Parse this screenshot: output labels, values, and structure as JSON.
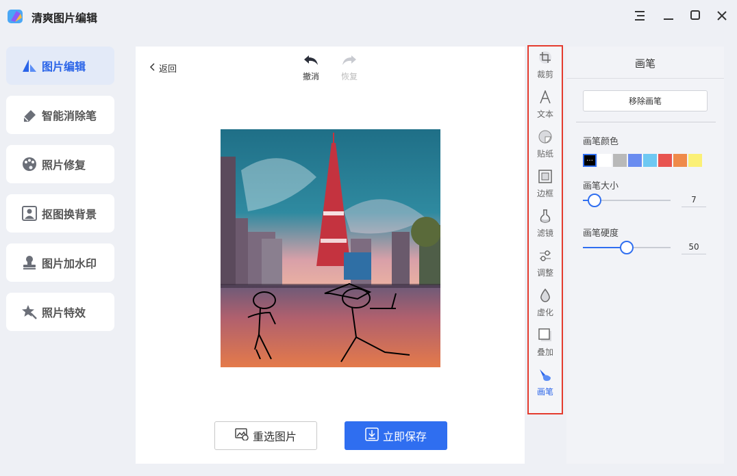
{
  "app": {
    "title": "清爽图片编辑"
  },
  "colors": {
    "accent": "#2f6ef0",
    "highlight_border": "#e43a2d"
  },
  "nav": {
    "items": [
      {
        "label": "图片编辑",
        "icon": "image-edit-icon",
        "active": true
      },
      {
        "label": "智能消除笔",
        "icon": "eraser-icon",
        "active": false
      },
      {
        "label": "照片修复",
        "icon": "palette-icon",
        "active": false
      },
      {
        "label": "抠图换背景",
        "icon": "portrait-cutout-icon",
        "active": false
      },
      {
        "label": "图片加水印",
        "icon": "stamp-icon",
        "active": false
      },
      {
        "label": "照片特效",
        "icon": "magic-wand-icon",
        "active": false
      }
    ]
  },
  "editor": {
    "back_label": "返回",
    "undo_label": "撤消",
    "redo_label": "恢复",
    "reselect_label": "重选图片",
    "save_label": "立即保存"
  },
  "tools": [
    {
      "label": "裁剪",
      "icon": "crop-icon",
      "active": false
    },
    {
      "label": "文本",
      "icon": "text-icon",
      "active": false
    },
    {
      "label": "贴纸",
      "icon": "sticker-icon",
      "active": false
    },
    {
      "label": "边框",
      "icon": "border-frame-icon",
      "active": false
    },
    {
      "label": "滤镜",
      "icon": "filter-flask-icon",
      "active": false
    },
    {
      "label": "调整",
      "icon": "adjust-sliders-icon",
      "active": false
    },
    {
      "label": "虚化",
      "icon": "blur-drop-icon",
      "active": false
    },
    {
      "label": "叠加",
      "icon": "overlay-icon",
      "active": false
    },
    {
      "label": "画笔",
      "icon": "brush-icon",
      "active": true
    }
  ],
  "brush_panel": {
    "title": "画笔",
    "remove_label": "移除画笔",
    "color_label": "画笔颜色",
    "colors": [
      "#000000",
      "#ffffff",
      "#b9b9b9",
      "#6a8cf0",
      "#6ec8f2",
      "#e85450",
      "#ef8a4a",
      "#fbf076"
    ],
    "selected_color": "#000000",
    "size_label": "画笔大小",
    "size_value": "7",
    "size_fraction": 0.13,
    "hardness_label": "画笔硬度",
    "hardness_value": "50",
    "hardness_fraction": 0.5
  }
}
